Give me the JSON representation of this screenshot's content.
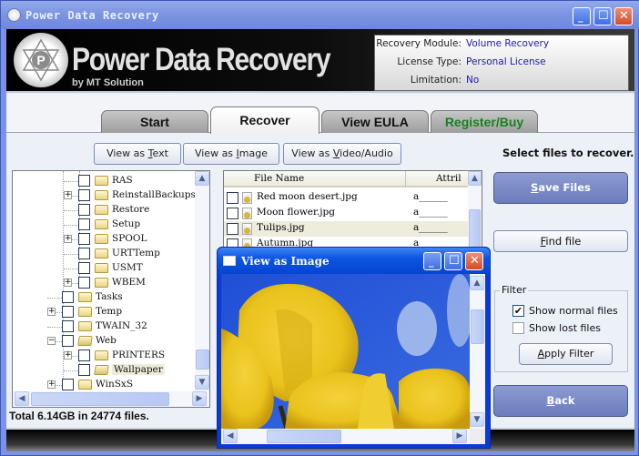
{
  "window": {
    "title": "Power Data Recovery",
    "controls": {
      "minimize": "_",
      "maximize": "☐",
      "close": "✕"
    }
  },
  "header": {
    "brand": "Power Data Recovery",
    "brand_sub": "by MT Solution",
    "logo_letter": "P",
    "info": [
      {
        "label": "Recovery Module:",
        "value": "Volume Recovery"
      },
      {
        "label": "License Type:",
        "value": "Personal License"
      },
      {
        "label": "Limitation:",
        "value": "No"
      }
    ]
  },
  "tabs": [
    {
      "label": "Start",
      "active": false
    },
    {
      "label": "Recover",
      "active": true
    },
    {
      "label": "View EULA",
      "active": false
    },
    {
      "label": "Register/Buy",
      "active": false,
      "color": "#17821c"
    }
  ],
  "view_buttons": {
    "text": {
      "pre": "View as ",
      "accel": "T",
      "post": "ext"
    },
    "image": {
      "pre": "View as ",
      "accel": "I",
      "post": "mage"
    },
    "video": {
      "pre": "View as ",
      "accel": "V",
      "post": "ideo/Audio"
    }
  },
  "select_label": "Select files to recover.",
  "tree": {
    "items": [
      {
        "label": "RAS",
        "expandable": false,
        "checked": false
      },
      {
        "label": "ReinstallBackups",
        "expandable": true,
        "expand_symbol": "+",
        "checked": false
      },
      {
        "label": "Restore",
        "expandable": false,
        "checked": false
      },
      {
        "label": "Setup",
        "expandable": false,
        "checked": false
      },
      {
        "label": "SPOOL",
        "expandable": true,
        "expand_symbol": "+",
        "checked": false
      },
      {
        "label": "URTTemp",
        "expandable": false,
        "checked": false
      },
      {
        "label": "USMT",
        "expandable": false,
        "checked": false
      },
      {
        "label": "WBEM",
        "expandable": true,
        "expand_symbol": "+",
        "checked": false
      },
      {
        "label": "Tasks",
        "expandable": false,
        "checked": false
      },
      {
        "label": "Temp",
        "expandable": true,
        "expand_symbol": "+",
        "checked": false
      },
      {
        "label": "TWAIN_32",
        "expandable": false,
        "checked": false
      },
      {
        "label": "Web",
        "expandable": true,
        "expand_symbol": "−",
        "checked": false,
        "open": true
      },
      {
        "label": "PRINTERS",
        "expandable": true,
        "expand_symbol": "+",
        "checked": false
      },
      {
        "label": "Wallpaper",
        "expandable": false,
        "checked": false,
        "selected": true,
        "open": true
      },
      {
        "label": "WinSxS",
        "expandable": true,
        "expand_symbol": "+",
        "checked": false
      }
    ]
  },
  "file_list": {
    "columns": [
      "File Name",
      "Attril"
    ],
    "rows": [
      {
        "name": "Red moon desert.jpg",
        "attr": "a______",
        "checked": false
      },
      {
        "name": "Moon flower.jpg",
        "attr": "a______",
        "checked": false
      },
      {
        "name": "Tulips.jpg",
        "attr": "a______",
        "checked": false,
        "highlighted": true
      },
      {
        "name": "Autumn.jpg",
        "attr": "a______",
        "checked": false
      }
    ]
  },
  "status": "Total 6.14GB in 24774 files.",
  "sidebar": {
    "save": {
      "accel": "S",
      "rest": "ave Files"
    },
    "find": {
      "accel": "F",
      "rest": "ind file"
    },
    "filter": {
      "legend": "Filter",
      "show_normal": {
        "label": "Show normal files",
        "checked": true
      },
      "show_lost": {
        "label": "Show lost files",
        "checked": false
      },
      "apply": {
        "accel": "A",
        "rest": "pply Filter"
      }
    },
    "back": {
      "accel": "B",
      "rest": "ack"
    }
  },
  "popup": {
    "title": "View as Image",
    "image_subject": "Yellow tulips against a blue sky"
  },
  "scroll_symbols": {
    "up": "▲",
    "down": "▼",
    "left": "◀",
    "right": "▶",
    "grip": "≡"
  }
}
